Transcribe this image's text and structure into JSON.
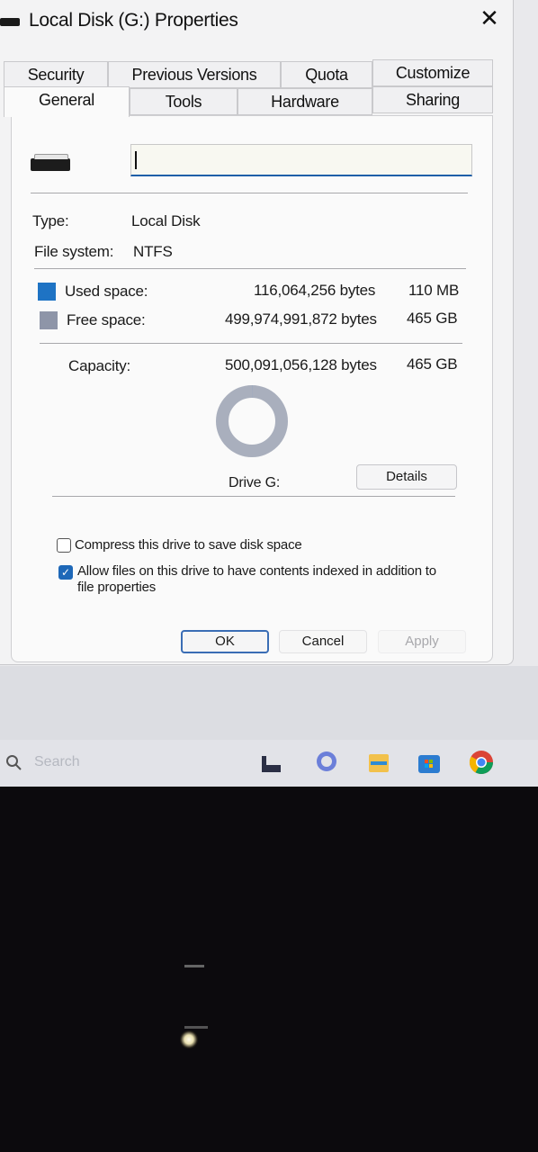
{
  "window": {
    "title": "Local Disk (G:) Properties",
    "close_glyph": "✕"
  },
  "tabs": {
    "row_back": [
      "Security",
      "Previous Versions",
      "Quota",
      "Customize"
    ],
    "row_front": [
      "General",
      "Tools",
      "Hardware",
      "Sharing"
    ],
    "active": "General"
  },
  "general": {
    "name_value": "",
    "type_label": "Type:",
    "type_value": "Local Disk",
    "fs_label": "File system:",
    "fs_value": "NTFS",
    "used_label": "Used space:",
    "used_bytes": "116,064,256 bytes",
    "used_size": "110 MB",
    "free_label": "Free space:",
    "free_bytes": "499,974,991,872 bytes",
    "free_size": "465 GB",
    "capacity_label": "Capacity:",
    "capacity_bytes": "500,091,056,128 bytes",
    "capacity_size": "465 GB",
    "drive_label": "Drive G:",
    "details_button": "Details",
    "used_fraction": 0.000232,
    "compress_label": "Compress this drive to save disk space",
    "compress_checked": false,
    "index_label_line1": "Allow files on this drive to have contents indexed in addition to",
    "index_label_line2": "file properties",
    "index_checked": true
  },
  "buttons": {
    "ok": "OK",
    "cancel": "Cancel",
    "apply": "Apply"
  },
  "taskbar": {
    "search_placeholder": "Search",
    "icons": [
      "task-view-icon",
      "chat-icon",
      "file-explorer-icon",
      "store-icon",
      "chrome-icon"
    ]
  },
  "colors": {
    "used": "#1e73c4",
    "free": "#8e95a8",
    "accent": "#1f5fa8"
  }
}
